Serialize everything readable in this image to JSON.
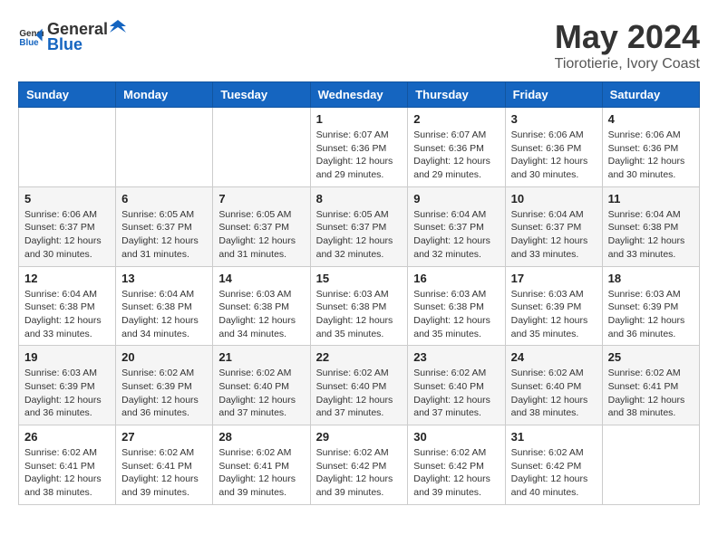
{
  "header": {
    "logo_general": "General",
    "logo_blue": "Blue",
    "month": "May 2024",
    "location": "Tiorotierie, Ivory Coast"
  },
  "weekdays": [
    "Sunday",
    "Monday",
    "Tuesday",
    "Wednesday",
    "Thursday",
    "Friday",
    "Saturday"
  ],
  "weeks": [
    [
      {
        "day": "",
        "sunrise": "",
        "sunset": "",
        "daylight": ""
      },
      {
        "day": "",
        "sunrise": "",
        "sunset": "",
        "daylight": ""
      },
      {
        "day": "",
        "sunrise": "",
        "sunset": "",
        "daylight": ""
      },
      {
        "day": "1",
        "sunrise": "Sunrise: 6:07 AM",
        "sunset": "Sunset: 6:36 PM",
        "daylight": "Daylight: 12 hours and 29 minutes."
      },
      {
        "day": "2",
        "sunrise": "Sunrise: 6:07 AM",
        "sunset": "Sunset: 6:36 PM",
        "daylight": "Daylight: 12 hours and 29 minutes."
      },
      {
        "day": "3",
        "sunrise": "Sunrise: 6:06 AM",
        "sunset": "Sunset: 6:36 PM",
        "daylight": "Daylight: 12 hours and 30 minutes."
      },
      {
        "day": "4",
        "sunrise": "Sunrise: 6:06 AM",
        "sunset": "Sunset: 6:36 PM",
        "daylight": "Daylight: 12 hours and 30 minutes."
      }
    ],
    [
      {
        "day": "5",
        "sunrise": "Sunrise: 6:06 AM",
        "sunset": "Sunset: 6:37 PM",
        "daylight": "Daylight: 12 hours and 30 minutes."
      },
      {
        "day": "6",
        "sunrise": "Sunrise: 6:05 AM",
        "sunset": "Sunset: 6:37 PM",
        "daylight": "Daylight: 12 hours and 31 minutes."
      },
      {
        "day": "7",
        "sunrise": "Sunrise: 6:05 AM",
        "sunset": "Sunset: 6:37 PM",
        "daylight": "Daylight: 12 hours and 31 minutes."
      },
      {
        "day": "8",
        "sunrise": "Sunrise: 6:05 AM",
        "sunset": "Sunset: 6:37 PM",
        "daylight": "Daylight: 12 hours and 32 minutes."
      },
      {
        "day": "9",
        "sunrise": "Sunrise: 6:04 AM",
        "sunset": "Sunset: 6:37 PM",
        "daylight": "Daylight: 12 hours and 32 minutes."
      },
      {
        "day": "10",
        "sunrise": "Sunrise: 6:04 AM",
        "sunset": "Sunset: 6:37 PM",
        "daylight": "Daylight: 12 hours and 33 minutes."
      },
      {
        "day": "11",
        "sunrise": "Sunrise: 6:04 AM",
        "sunset": "Sunset: 6:38 PM",
        "daylight": "Daylight: 12 hours and 33 minutes."
      }
    ],
    [
      {
        "day": "12",
        "sunrise": "Sunrise: 6:04 AM",
        "sunset": "Sunset: 6:38 PM",
        "daylight": "Daylight: 12 hours and 33 minutes."
      },
      {
        "day": "13",
        "sunrise": "Sunrise: 6:04 AM",
        "sunset": "Sunset: 6:38 PM",
        "daylight": "Daylight: 12 hours and 34 minutes."
      },
      {
        "day": "14",
        "sunrise": "Sunrise: 6:03 AM",
        "sunset": "Sunset: 6:38 PM",
        "daylight": "Daylight: 12 hours and 34 minutes."
      },
      {
        "day": "15",
        "sunrise": "Sunrise: 6:03 AM",
        "sunset": "Sunset: 6:38 PM",
        "daylight": "Daylight: 12 hours and 35 minutes."
      },
      {
        "day": "16",
        "sunrise": "Sunrise: 6:03 AM",
        "sunset": "Sunset: 6:38 PM",
        "daylight": "Daylight: 12 hours and 35 minutes."
      },
      {
        "day": "17",
        "sunrise": "Sunrise: 6:03 AM",
        "sunset": "Sunset: 6:39 PM",
        "daylight": "Daylight: 12 hours and 35 minutes."
      },
      {
        "day": "18",
        "sunrise": "Sunrise: 6:03 AM",
        "sunset": "Sunset: 6:39 PM",
        "daylight": "Daylight: 12 hours and 36 minutes."
      }
    ],
    [
      {
        "day": "19",
        "sunrise": "Sunrise: 6:03 AM",
        "sunset": "Sunset: 6:39 PM",
        "daylight": "Daylight: 12 hours and 36 minutes."
      },
      {
        "day": "20",
        "sunrise": "Sunrise: 6:02 AM",
        "sunset": "Sunset: 6:39 PM",
        "daylight": "Daylight: 12 hours and 36 minutes."
      },
      {
        "day": "21",
        "sunrise": "Sunrise: 6:02 AM",
        "sunset": "Sunset: 6:40 PM",
        "daylight": "Daylight: 12 hours and 37 minutes."
      },
      {
        "day": "22",
        "sunrise": "Sunrise: 6:02 AM",
        "sunset": "Sunset: 6:40 PM",
        "daylight": "Daylight: 12 hours and 37 minutes."
      },
      {
        "day": "23",
        "sunrise": "Sunrise: 6:02 AM",
        "sunset": "Sunset: 6:40 PM",
        "daylight": "Daylight: 12 hours and 37 minutes."
      },
      {
        "day": "24",
        "sunrise": "Sunrise: 6:02 AM",
        "sunset": "Sunset: 6:40 PM",
        "daylight": "Daylight: 12 hours and 38 minutes."
      },
      {
        "day": "25",
        "sunrise": "Sunrise: 6:02 AM",
        "sunset": "Sunset: 6:41 PM",
        "daylight": "Daylight: 12 hours and 38 minutes."
      }
    ],
    [
      {
        "day": "26",
        "sunrise": "Sunrise: 6:02 AM",
        "sunset": "Sunset: 6:41 PM",
        "daylight": "Daylight: 12 hours and 38 minutes."
      },
      {
        "day": "27",
        "sunrise": "Sunrise: 6:02 AM",
        "sunset": "Sunset: 6:41 PM",
        "daylight": "Daylight: 12 hours and 39 minutes."
      },
      {
        "day": "28",
        "sunrise": "Sunrise: 6:02 AM",
        "sunset": "Sunset: 6:41 PM",
        "daylight": "Daylight: 12 hours and 39 minutes."
      },
      {
        "day": "29",
        "sunrise": "Sunrise: 6:02 AM",
        "sunset": "Sunset: 6:42 PM",
        "daylight": "Daylight: 12 hours and 39 minutes."
      },
      {
        "day": "30",
        "sunrise": "Sunrise: 6:02 AM",
        "sunset": "Sunset: 6:42 PM",
        "daylight": "Daylight: 12 hours and 39 minutes."
      },
      {
        "day": "31",
        "sunrise": "Sunrise: 6:02 AM",
        "sunset": "Sunset: 6:42 PM",
        "daylight": "Daylight: 12 hours and 40 minutes."
      },
      {
        "day": "",
        "sunrise": "",
        "sunset": "",
        "daylight": ""
      }
    ]
  ]
}
